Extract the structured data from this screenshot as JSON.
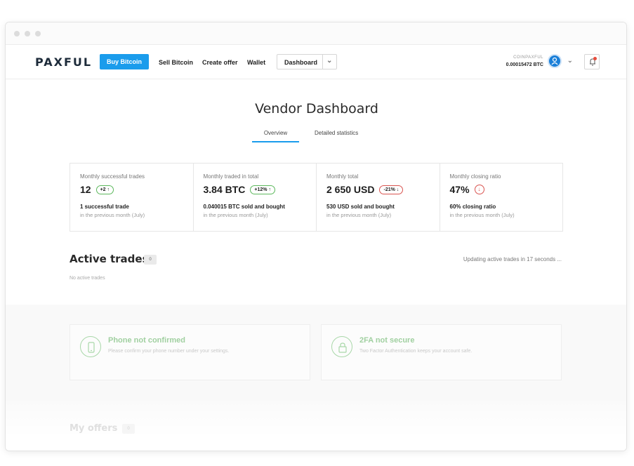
{
  "nav": {
    "logo": "PAXFUL",
    "buy_label": "Buy Bitcoin",
    "sell_label": "Sell Bitcoin",
    "create_label": "Create offer",
    "wallet_label": "Wallet",
    "dashboard_select": "Dashboard",
    "username": "COINPAXFUL",
    "balance": "0.00015472 BTC"
  },
  "page": {
    "title": "Vendor Dashboard",
    "tabs": [
      {
        "label": "Overview",
        "active": true
      },
      {
        "label": "Detailed statistics",
        "active": false
      }
    ]
  },
  "stats": [
    {
      "label": "Monthly successful trades",
      "value": "12",
      "badge": "+2 ↑",
      "sub1": "1 successful trade",
      "sub2": "in the previous month (July)"
    },
    {
      "label": "Monthly traded in total",
      "value": "3.84 BTC",
      "badge": "+12% ↑",
      "sub1": "0.040015 BTC sold and bought",
      "sub2": "in the previous month (July)"
    },
    {
      "label": "Monthly total",
      "value": "2 650 USD",
      "badge": "-21% ↓",
      "sub1": "530 USD sold and bought",
      "sub2": "in the previous month (July)"
    },
    {
      "label": "Monthly closing ratio",
      "value": "47%",
      "badge": "↓",
      "sub1": "60% closing ratio",
      "sub2": "in the previous month (July)"
    }
  ],
  "active": {
    "title": "Active trades",
    "count": "0",
    "updating": "Updating active trades in 17 seconds ...",
    "empty": "No active trades"
  },
  "cards": [
    {
      "title": "Phone not confirmed",
      "desc": "Please confirm your phone number under your settings."
    },
    {
      "title": "2FA not secure",
      "desc": "Two Factor Authentication keeps your account safe."
    }
  ],
  "offers": {
    "title": "My offers",
    "count": "0"
  },
  "colors": {
    "accent": "#1a9cec",
    "success": "#5cb85c",
    "danger": "#d9534f"
  }
}
